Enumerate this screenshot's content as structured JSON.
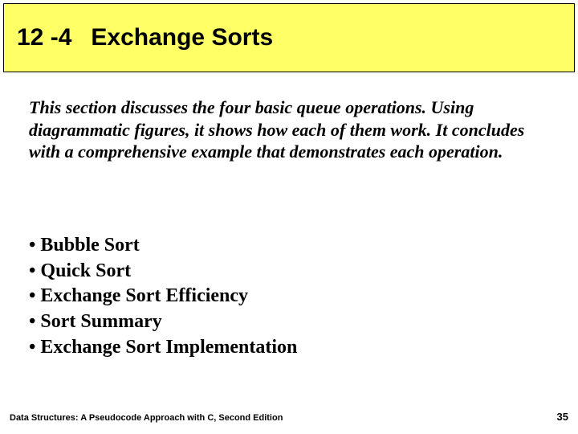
{
  "title": {
    "number": "12 -4",
    "text": "Exchange Sorts"
  },
  "intro": "This section discusses the four basic queue operations. Using diagrammatic figures, it shows how each of them work. It concludes with a comprehensive example that demonstrates each operation.",
  "bullets": [
    "Bubble Sort",
    "Quick Sort",
    "Exchange Sort Efficiency",
    "Sort Summary",
    "Exchange Sort Implementation"
  ],
  "footer": {
    "source": "Data Structures: A Pseudocode Approach with C, Second Edition",
    "page": "35"
  }
}
